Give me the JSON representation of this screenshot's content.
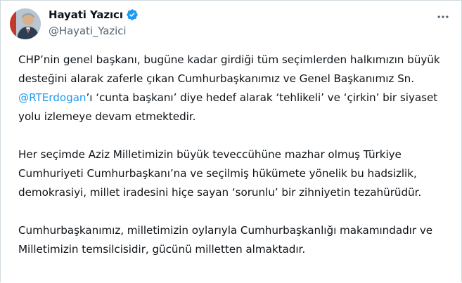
{
  "author": {
    "display_name": "Hayati Yazıcı",
    "handle": "@Hayati_Yazici",
    "verified": true,
    "verified_color": "#1d9bf0"
  },
  "menu": {
    "icon": "more-horizontal-icon"
  },
  "tweet": {
    "p1": {
      "before": "CHP’nin genel başkanı, bugüne kadar girdiği tüm seçimlerden halkımızın büyük desteğini alarak zaferle çıkan Cumhurbaşkanımız ve Genel Başkanımız Sn. ",
      "mention": "@RTErdogan",
      "after": "’ı ‘cunta başkanı’ diye hedef alarak ‘tehlikeli’ ve ‘çirkin’ bir siyaset yolu izlemeye devam etmektedir."
    },
    "p2": "Her seçimde Aziz Milletimizin büyük teveccühüne mazhar olmuş Türkiye Cumhuriyeti Cumhurbaşkanı’na ve seçilmiş hükümete yönelik bu hadsizlik, demokrasiyi, millet iradesini hiçe sayan ‘sorunlu’ bir zihniyetin tezahürüdür.",
    "p3": "Cumhurbaşkanımız, milletimizin oylarıyla Cumhurbaşkanlığı makamındadır ve Milletimizin  temsilcisidir, gücünü milletten almaktadır."
  },
  "colors": {
    "text": "#0f1419",
    "secondary": "#536471",
    "link": "#1d9bf0"
  }
}
